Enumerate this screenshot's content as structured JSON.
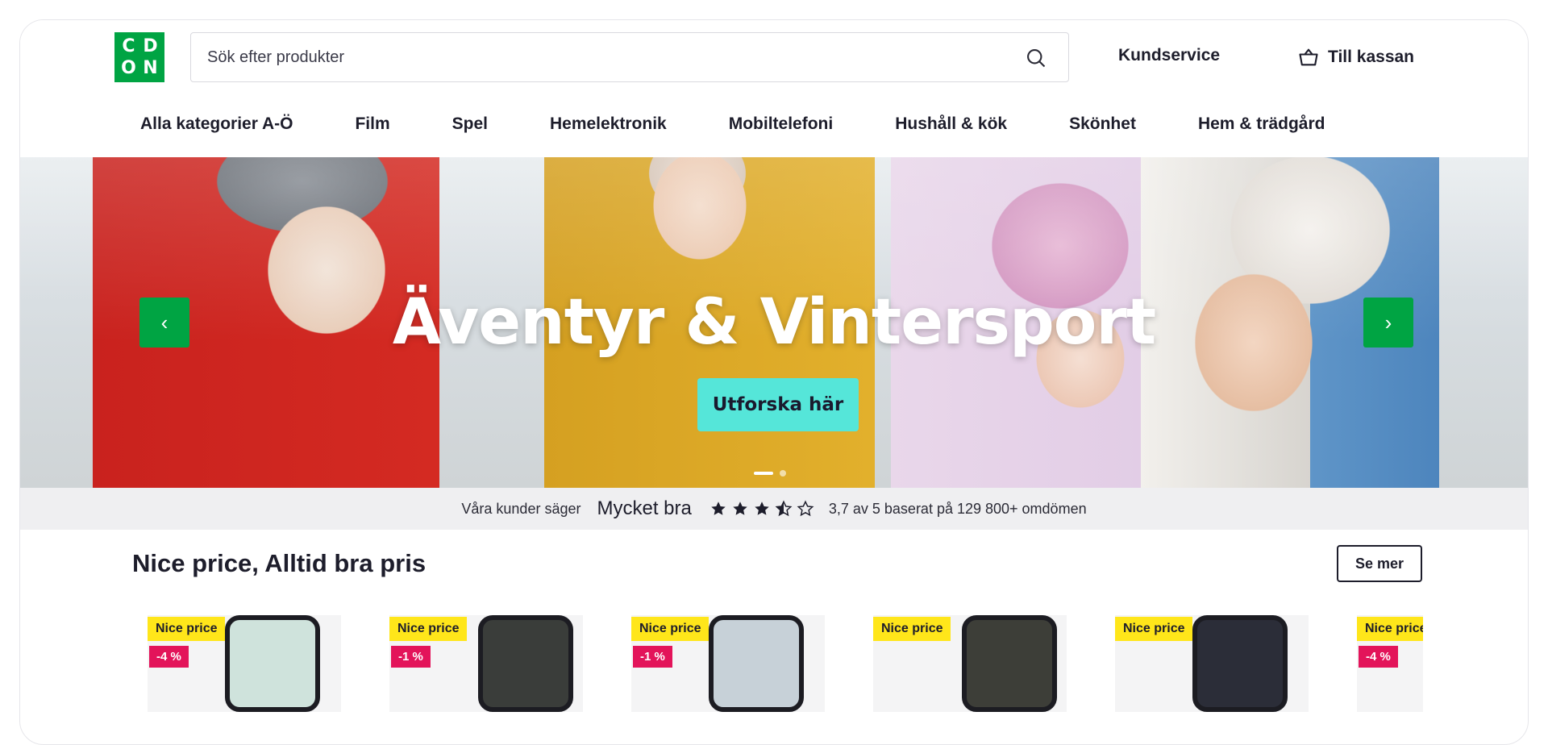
{
  "logo": {
    "letters": [
      "C",
      "D",
      "O",
      "N"
    ]
  },
  "search": {
    "placeholder": "Sök efter produkter",
    "icon": "search-icon"
  },
  "header": {
    "customer_service": "Kundservice",
    "cart_label": "Till kassan",
    "cart_icon": "basket-icon"
  },
  "nav": {
    "items": [
      "Alla kategorier A-Ö",
      "Film",
      "Spel",
      "Hemelektronik",
      "Mobiltelefoni",
      "Hushåll & kök",
      "Skönhet",
      "Hem & trädgård"
    ]
  },
  "hero": {
    "title": "Äventyr & Vintersport",
    "cta": "Utforska här",
    "prev_icon": "chevron-left-icon",
    "next_icon": "chevron-right-icon",
    "prev_glyph": "‹",
    "next_glyph": "›"
  },
  "rating": {
    "intro": "Våra kunder säger",
    "word": "Mycket bra",
    "stars": 3.5,
    "summary": "3,7 av 5 baserat på 129 800+ omdömen"
  },
  "section": {
    "title": "Nice price, Alltid bra pris",
    "more_label": "Se mer"
  },
  "products": [
    {
      "badge": "Nice price",
      "discount": "-4 %",
      "color": "#cfe3dc"
    },
    {
      "badge": "Nice price",
      "discount": "-1 %",
      "color": "#3a3d3a"
    },
    {
      "badge": "Nice price",
      "discount": "-1 %",
      "color": "#c7d1d8"
    },
    {
      "badge": "Nice price",
      "discount": "",
      "color": "#3d3e38"
    },
    {
      "badge": "Nice price",
      "discount": "",
      "color": "#2b2d38"
    },
    {
      "badge": "Nice price",
      "discount": "-4 %",
      "color": "#d5dad6"
    }
  ],
  "colors": {
    "brand_green": "#00a443",
    "cta_teal": "#55e6d9",
    "badge_yellow": "#ffe61a",
    "badge_pink": "#e3145a"
  }
}
